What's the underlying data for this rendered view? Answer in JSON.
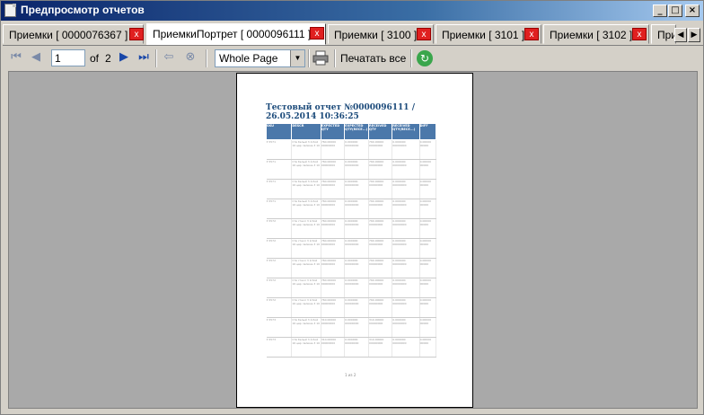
{
  "window": {
    "title": "Предпросмотр отчетов"
  },
  "tabs": [
    {
      "label": "Приемки [ 0000076367 ]"
    },
    {
      "label": "ПриемкиПортрет [ 0000096111 ]"
    },
    {
      "label": "Приемки [ 3100 ]"
    },
    {
      "label": "Приемки [ 3101 ]"
    },
    {
      "label": "Приемки [ 3102 ]"
    },
    {
      "label": "При"
    }
  ],
  "toolbar": {
    "page_value": "1",
    "of_label": "of",
    "total_pages": "2",
    "zoom_value": "Whole Page",
    "print_all_label": "Печатать все"
  },
  "report": {
    "title": "Тестовый отчет №0000096111 / 26.05.2014 10:36:25",
    "columns": [
      "SKU",
      "DESCR",
      "EXPECTED QTY",
      "EXPECTED QTY(RECE...)",
      "RECEIVED QTY",
      "RECEIVED QTY(RECE...)",
      "DIFF"
    ],
    "rows": [
      [
        "3 5571",
        "Ств белый 3 й бой 16 цвр лвлиме 3 10",
        "760.00000 00000000",
        "0.000000 00000000",
        "760.00000 00000000",
        "0.000000 00000000",
        "0.00000 00000"
      ],
      [
        "3 5571",
        "Ств белый 3 й бой 16 цвр лвлиме 3 10",
        "760.00000 00000000",
        "0.000000 00000000",
        "760.00000 00000000",
        "0.000000 00000000",
        "0.00000 00000"
      ],
      [
        "3 5571",
        "Ств белый 3 й бой 16 цвр лвлиме 3 10",
        "760.00000 00000000",
        "0.000000 00000000",
        "760.00000 00000000",
        "0.000000 00000000",
        "0.00000 00000"
      ],
      [
        "3 5571",
        "Ств белый 3 й бой 16 цвр лвлиме 3 10",
        "760.00000 00000000",
        "0.000000 00000000",
        "760.00000 00000000",
        "0.000000 00000000",
        "0.00000 00000"
      ],
      [
        "3 5572",
        "Ств стекл 3 й бой 16 цвр лвлиме 3 10",
        "760.00000 00000000",
        "0.000000 00000000",
        "760.00000 00000000",
        "0.000000 00000000",
        "0.00000 00000"
      ],
      [
        "3 5572",
        "Ств стекл 3 й бой 16 цвр лвлиме 3 10",
        "760.00000 00000000",
        "0.000000 00000000",
        "760.00000 00000000",
        "0.000000 00000000",
        "0.00000 00000"
      ],
      [
        "3 5572",
        "Ств стекл 3 й бой 16 цвр лвлиме 3 10",
        "760.00000 00000000",
        "0.000000 00000000",
        "760.00000 00000000",
        "0.000000 00000000",
        "0.00000 00000"
      ],
      [
        "3 5572",
        "Ств стекл 3 й бой 16 цвр лвлиме 3 10",
        "760.00000 00000000",
        "0.000000 00000000",
        "760.00000 00000000",
        "0.000000 00000000",
        "0.00000 00000"
      ],
      [
        "3 5572",
        "Ств стекл 3 й бой 16 цвр лвлиме 3 10",
        "760.00000 00000000",
        "0.000000 00000000",
        "760.00000 00000000",
        "0.000000 00000000",
        "0.00000 00000"
      ],
      [
        "3 5573",
        "Ств белый 3 й бой 16 цвр лвлиме 3 10",
        "310.00000 00000000",
        "0.000000 00000000",
        "310.00000 00000000",
        "0.000000 00000000",
        "0.00000 00000"
      ],
      [
        "3 5573",
        "Ств белый 3 й бой 16 цвр лвлиме 3 10",
        "310.00000 00000000",
        "0.000000 00000000",
        "310.00000 00000000",
        "0.000000 00000000",
        "0.00000 00000"
      ]
    ],
    "footer": "1 из 2"
  }
}
